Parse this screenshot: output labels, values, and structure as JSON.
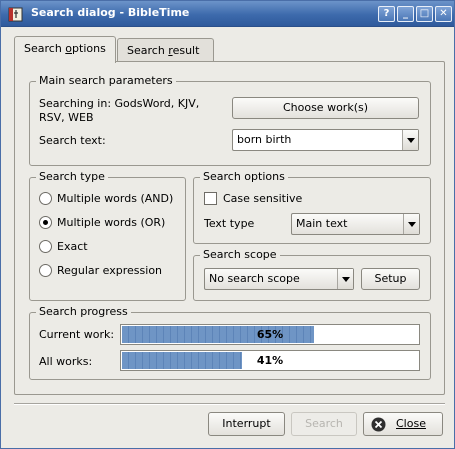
{
  "window": {
    "title": "Search dialog - BibleTime",
    "controls": [
      "?",
      "_",
      "□",
      "✕"
    ]
  },
  "tabs": [
    {
      "label_pre": "Search ",
      "label_ul": "o",
      "label_post": "ptions",
      "active": true
    },
    {
      "label_pre": "Search ",
      "label_ul": "r",
      "label_post": "esult",
      "active": false
    }
  ],
  "main_params": {
    "title": "Main search parameters",
    "searching_in_line1": "Searching in: GodsWord, KJV,",
    "searching_in_line2": "RSV, WEB",
    "choose_button": "Choose work(s)",
    "search_text_label": "Search text:",
    "search_text_value": "born birth"
  },
  "search_type": {
    "title": "Search type",
    "options": [
      {
        "label": "Multiple words (AND)",
        "selected": false
      },
      {
        "label": "Multiple words (OR)",
        "selected": true
      },
      {
        "label": "Exact",
        "selected": false
      },
      {
        "label": "Regular expression",
        "selected": false
      }
    ]
  },
  "search_options": {
    "title": "Search options",
    "case_sensitive_label": "Case sensitive",
    "case_sensitive_checked": false,
    "text_type_label": "Text type",
    "text_type_value": "Main text"
  },
  "search_scope": {
    "title": "Search scope",
    "scope_value": "No search scope",
    "setup_button": "Setup"
  },
  "search_progress": {
    "title": "Search progress",
    "current_work_label": "Current work:",
    "current_work_percent": 65,
    "current_work_text": "65%",
    "all_works_label": "All works:",
    "all_works_percent": 41,
    "all_works_text": "41%"
  },
  "footer": {
    "interrupt_button": "Interrupt",
    "search_button": "Search",
    "close_button": "Close"
  },
  "colors": {
    "titlebar": "#3d6aac",
    "progress_fill": "#6f95c5",
    "window_bg": "#ecebe6"
  }
}
